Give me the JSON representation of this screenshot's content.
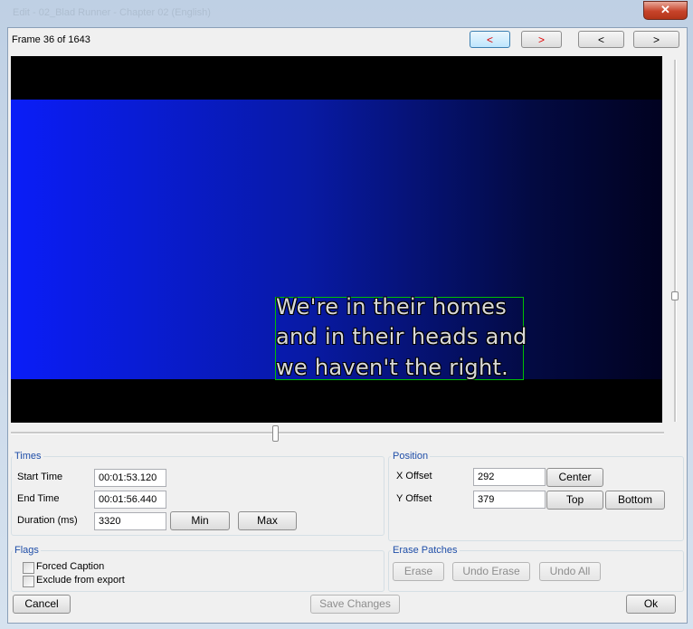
{
  "window": {
    "title": "Edit - 02_Blad Runner - Chapter 02 (English)"
  },
  "header": {
    "frame_info": "Frame 36 of 1643",
    "prev_red_label": "<",
    "next_red_label": ">",
    "prev_label": "<",
    "next_label": ">"
  },
  "preview": {
    "subtitle_lines": [
      "We're in their homes",
      "and in their heads and",
      "we haven't the right."
    ]
  },
  "times": {
    "group_label": "Times",
    "start_label": "Start Time",
    "start_value": "00:01:53.120",
    "end_label": "End Time",
    "end_value": "00:01:56.440",
    "duration_label": "Duration (ms)",
    "duration_value": "3320",
    "min_label": "Min",
    "max_label": "Max"
  },
  "position": {
    "group_label": "Position",
    "x_label": "X Offset",
    "x_value": "292",
    "y_label": "Y Offset",
    "y_value": "379",
    "center_label": "Center",
    "top_label": "Top",
    "bottom_label": "Bottom"
  },
  "flags": {
    "group_label": "Flags",
    "forced_label": "Forced Caption",
    "forced_checked": false,
    "exclude_label": "Exclude from export",
    "exclude_checked": false
  },
  "erase": {
    "group_label": "Erase Patches",
    "erase_label": "Erase",
    "undo_erase_label": "Undo Erase",
    "undo_all_label": "Undo All"
  },
  "footer": {
    "cancel_label": "Cancel",
    "save_label": "Save Changes",
    "ok_label": "Ok"
  },
  "colors": {
    "accent_text": "#1f4ea8",
    "nav_arrow_red": "#e00000",
    "subtitle_box": "#00c000",
    "video_band_start": "#0a1df8"
  }
}
